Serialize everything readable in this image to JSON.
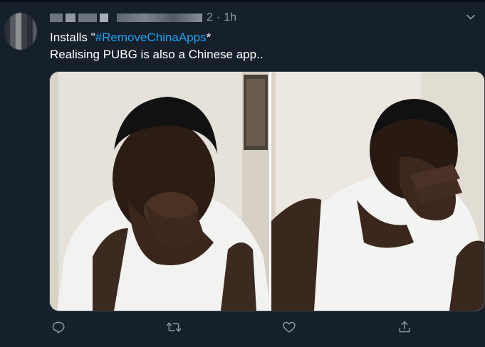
{
  "tweet": {
    "handle_suffix": "2",
    "separator": "·",
    "time": "1h",
    "line1": {
      "prefix": "Installs \"",
      "hashtag": "#RemoveChinaApps",
      "suffix": "*"
    },
    "line2": "Realising PUBG is also a Chinese app.."
  },
  "icons": {
    "menu": "chevron-down-icon",
    "reply": "reply-icon",
    "retweet": "retweet-icon",
    "like": "like-icon",
    "share": "share-icon"
  },
  "colors": {
    "background": "#15202b",
    "hashtag": "#1da1f2",
    "muted": "#8899a6"
  }
}
